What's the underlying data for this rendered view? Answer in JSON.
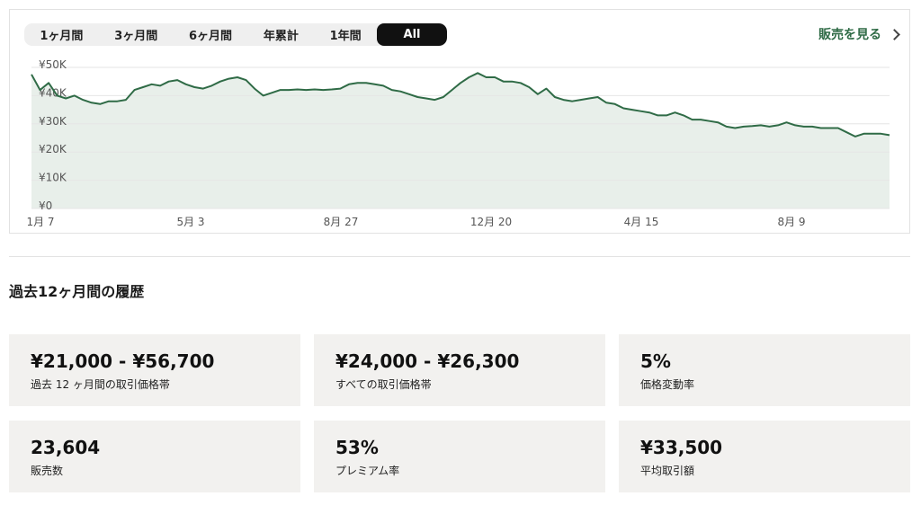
{
  "tabs": {
    "items": [
      "1ヶ月間",
      "3ヶ月間",
      "6ヶ月間",
      "年累計",
      "1年間",
      "All"
    ],
    "active": "All"
  },
  "view_sales_link": "販売を見る",
  "colors": {
    "line": "#2f6b46",
    "area": "#e8efea",
    "accent": "#2f6b46",
    "card_bg": "#f2f1ef"
  },
  "chart_data": {
    "type": "area",
    "y_tick_labels": [
      "¥0",
      "¥10K",
      "¥20K",
      "¥30K",
      "¥40K",
      "¥50K"
    ],
    "ylim": [
      0,
      50000
    ],
    "x_tick_labels": [
      "1月 7",
      "5月 3",
      "8月 27",
      "12月 20",
      "4月 15",
      "8月 9"
    ],
    "grid": true,
    "series": [
      {
        "values": [
          47500,
          42000,
          44500,
          40000,
          39000,
          40000,
          38500,
          37500,
          37000,
          38000,
          38000,
          38500,
          42000,
          43000,
          44000,
          43500,
          45000,
          45500,
          44000,
          43000,
          42500,
          43500,
          45000,
          46000,
          46500,
          45500,
          42500,
          40000,
          41000,
          42000,
          42000,
          42200,
          42000,
          42200,
          42000,
          42200,
          42500,
          44000,
          44500,
          44500,
          44000,
          43500,
          42000,
          41500,
          40500,
          39500,
          39000,
          38500,
          39500,
          42000,
          44500,
          46500,
          48000,
          46500,
          46500,
          45000,
          45000,
          44500,
          43000,
          40500,
          42500,
          39500,
          38500,
          38000,
          38500,
          39000,
          39500,
          37500,
          37000,
          35500,
          35000,
          34500,
          34000,
          33000,
          33000,
          34000,
          33000,
          31500,
          31500,
          31000,
          30500,
          29000,
          28500,
          29000,
          29200,
          29500,
          29000,
          29500,
          30500,
          29500,
          29000,
          29000,
          28500,
          28500,
          28500,
          27000,
          25500,
          26500,
          26500,
          26500,
          26000
        ]
      }
    ]
  },
  "history": {
    "title": "過去12ヶ月間の履歴",
    "stats": [
      {
        "value": "¥21,000 - ¥56,700",
        "label": "過去 12 ヶ月間の取引価格帯"
      },
      {
        "value": "¥24,000 - ¥26,300",
        "label": "すべての取引価格帯"
      },
      {
        "value": "5%",
        "label": "価格変動率"
      },
      {
        "value": "23,604",
        "label": "販売数"
      },
      {
        "value": "53%",
        "label": "プレミアム率"
      },
      {
        "value": "¥33,500",
        "label": "平均取引額"
      }
    ]
  }
}
